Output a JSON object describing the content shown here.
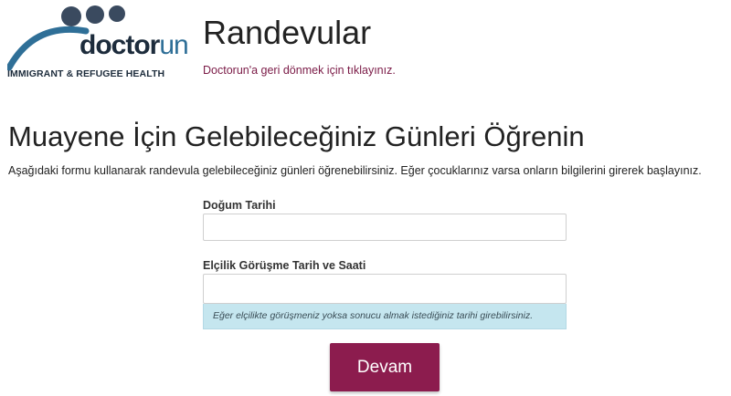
{
  "logo": {
    "word_main": "doctor",
    "word_accent": "un",
    "tagline": "IMMIGRANT & REFUGEE HEALTH",
    "colors": {
      "dark": "#1d2c3c",
      "blue": "#2f6f97",
      "dots": "#3a4a5f"
    }
  },
  "header": {
    "title": "Randevular",
    "back_link": "Doctorun'a geri dönmek için tıklayınız."
  },
  "main": {
    "heading": "Muayene İçin Gelebileceğiniz Günleri Öğrenin",
    "intro": "Aşağıdaki formu kullanarak randevula gelebileceğiniz günleri öğrenebilirsiniz. Eğer çocuklarınız varsa onların bilgilerini girerek başlayınız."
  },
  "form": {
    "birth_date": {
      "label": "Doğum Tarihi",
      "value": ""
    },
    "embassy": {
      "label": "Elçilik Görüşme Tarih ve Saati",
      "value": "",
      "hint": "Eğer elçilikte görüşmeniz yoksa sonucu almak istediğiniz tarihi girebilirsiniz."
    },
    "submit_label": "Devam"
  },
  "colors": {
    "accent": "#8c1c4e",
    "link": "#7a1a46",
    "hint_bg": "#c5e6ef"
  }
}
